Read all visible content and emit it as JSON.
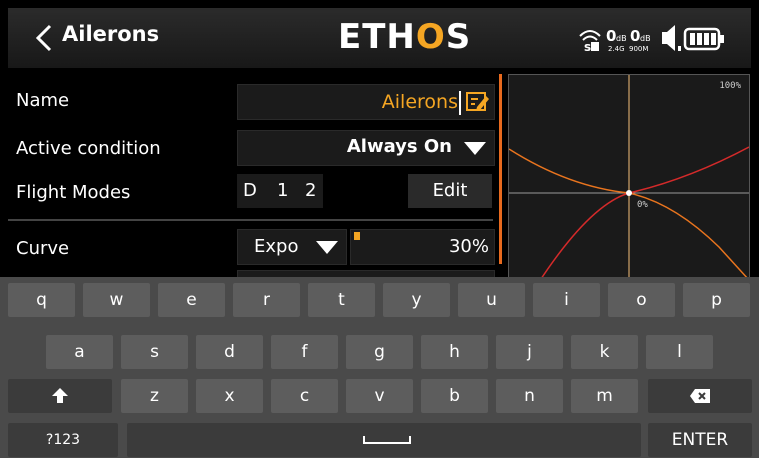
{
  "header": {
    "title": "Ailerons",
    "brand": {
      "pre": "ETH",
      "accent": "O",
      "post": "S"
    },
    "status": {
      "rssi1": "0",
      "rssi1_unit": "dB",
      "rssi1_band": "2.4G",
      "rssi2": "0",
      "rssi2_unit": "dB",
      "rssi2_band": "900M"
    }
  },
  "form": {
    "name_label": "Name",
    "name_value": "Ailerons",
    "condition_label": "Active condition",
    "condition_value": "Always On",
    "flight_modes_label": "Flight Modes",
    "flight_modes": [
      "D",
      "1",
      "2"
    ],
    "edit_label": "Edit",
    "curve_label": "Curve",
    "curve_type": "Expo",
    "curve_value": "30%",
    "curve_value_fraction": 0.3
  },
  "graph": {
    "max_label": "100%",
    "zero_label": "0%"
  },
  "keyboard": {
    "row1": [
      "q",
      "w",
      "e",
      "r",
      "t",
      "y",
      "u",
      "i",
      "o",
      "p"
    ],
    "row2": [
      "a",
      "s",
      "d",
      "f",
      "g",
      "h",
      "j",
      "k",
      "l"
    ],
    "row3": [
      "z",
      "x",
      "c",
      "v",
      "b",
      "n",
      "m"
    ],
    "mode_key": "?123",
    "enter_key": "ENTER"
  },
  "colors": {
    "accent": "#f5a623",
    "orange_bar": "#e86a1e",
    "curve_red": "#d42a2a",
    "curve_orange": "#e8741e"
  }
}
